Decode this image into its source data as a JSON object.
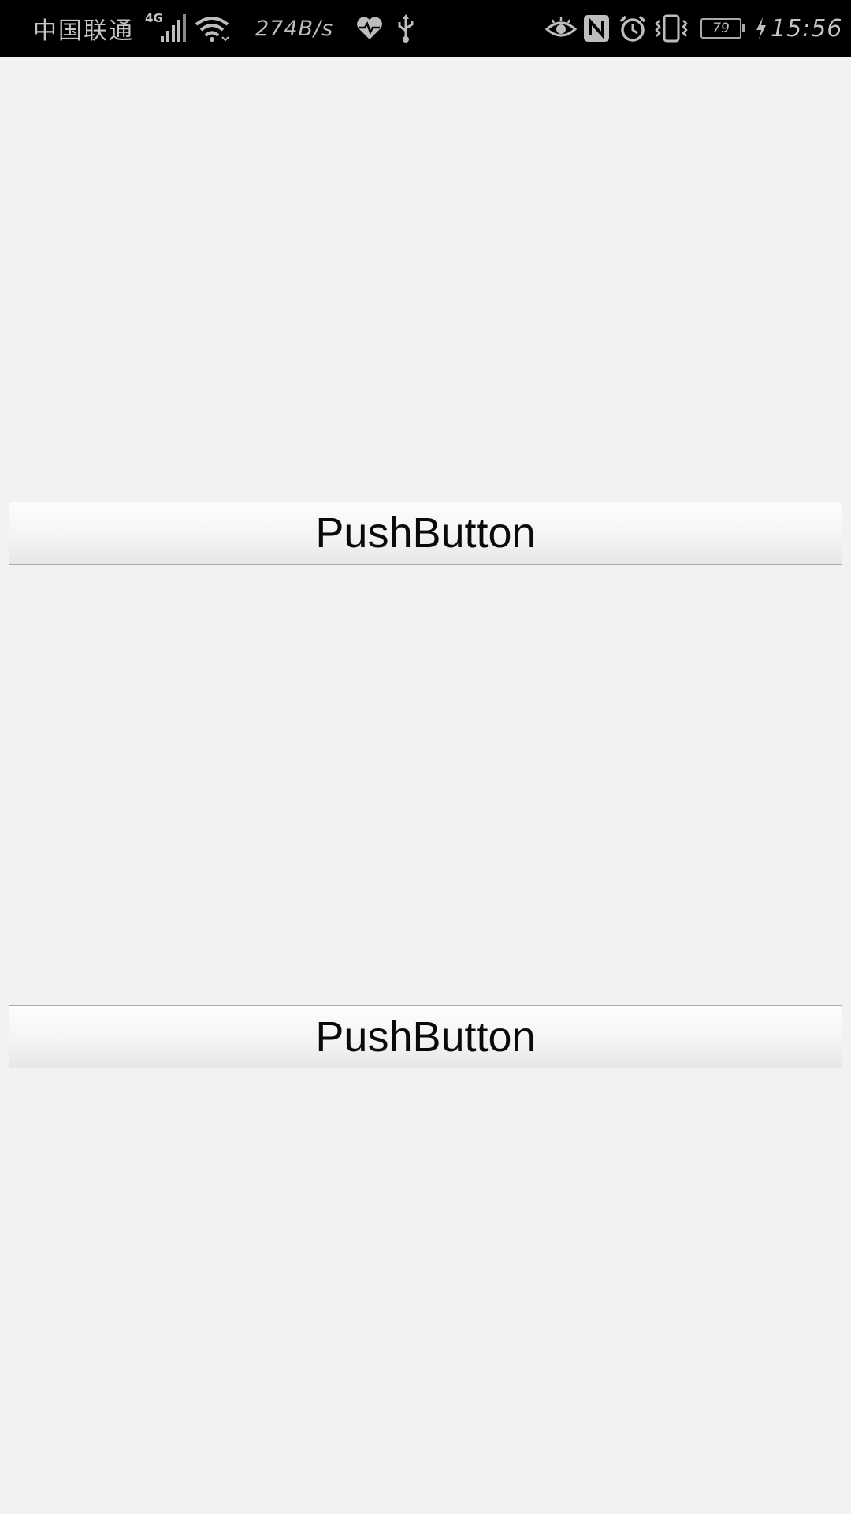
{
  "status_bar": {
    "carrier": "中国联通",
    "network_generation": "4G",
    "net_speed": "274B/s",
    "battery_level": "79",
    "time": "15:56",
    "icons": [
      "signal-icon",
      "wifi-icon",
      "heart-rate-icon",
      "usb-icon",
      "eye-comfort-icon",
      "nfc-icon",
      "alarm-icon",
      "vibrate-icon",
      "battery-icon",
      "charging-icon"
    ]
  },
  "buttons": [
    {
      "label": "PushButton"
    },
    {
      "label": "PushButton"
    }
  ],
  "colors": {
    "status_bar_bg": "#000000",
    "page_bg": "#f2f2f2",
    "button_border": "#ababab",
    "button_text": "#0a0a0a"
  }
}
